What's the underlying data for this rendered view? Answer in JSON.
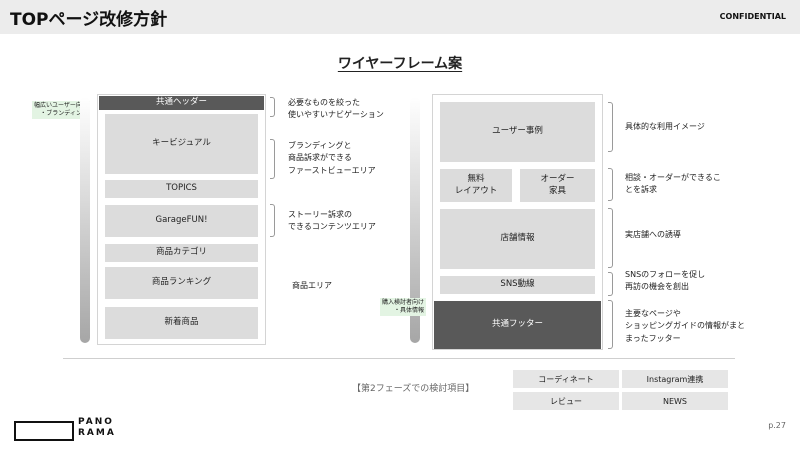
{
  "header": {
    "title": "TOPページ改修方針",
    "confidential": "CONFIDENTIAL"
  },
  "wireframe_title": "ワイヤーフレーム案",
  "left": {
    "tag": [
      "幅広いユーザー向け",
      "・ブランディング"
    ],
    "blocks": [
      "共通ヘッダー",
      "キービジュアル",
      "TOPICS",
      "GarageFUN!",
      "商品カテゴリ",
      "商品ランキング",
      "新着商品"
    ],
    "descs": [
      [
        "必要なものを絞った",
        "使いやすいナビゲーション"
      ],
      [
        "ブランディングと",
        "商品訴求ができる",
        "ファーストビューエリア"
      ],
      [
        "ストーリー訴求の",
        "できるコンテンツエリア"
      ],
      [
        "商品エリア"
      ]
    ]
  },
  "right": {
    "tag": [
      "購入検討者向け",
      "・具体情報"
    ],
    "blocks": [
      "ユーザー事例",
      "無料\nレイアウト",
      "オーダー\n家具",
      "店舗情報",
      "SNS動線",
      "共通フッター"
    ],
    "descs": [
      [
        "具体的な利用イメージ"
      ],
      [
        "相談・オーダーができるこ",
        "とを訴求"
      ],
      [
        "実店舗への誘導"
      ],
      [
        "SNSのフォローを促し",
        "再訪の機会を創出"
      ],
      [
        "主要なページや",
        "ショッピングガイドの情報がまと",
        "まったフッター"
      ]
    ]
  },
  "phase2": {
    "label": "【第2フェーズでの検討項目】",
    "items": [
      "コーディネート",
      "Instagram連携",
      "レビュー",
      "NEWS"
    ]
  },
  "logo": {
    "line1": "PANO",
    "line2": "RAMA"
  },
  "page_number": "p.27"
}
